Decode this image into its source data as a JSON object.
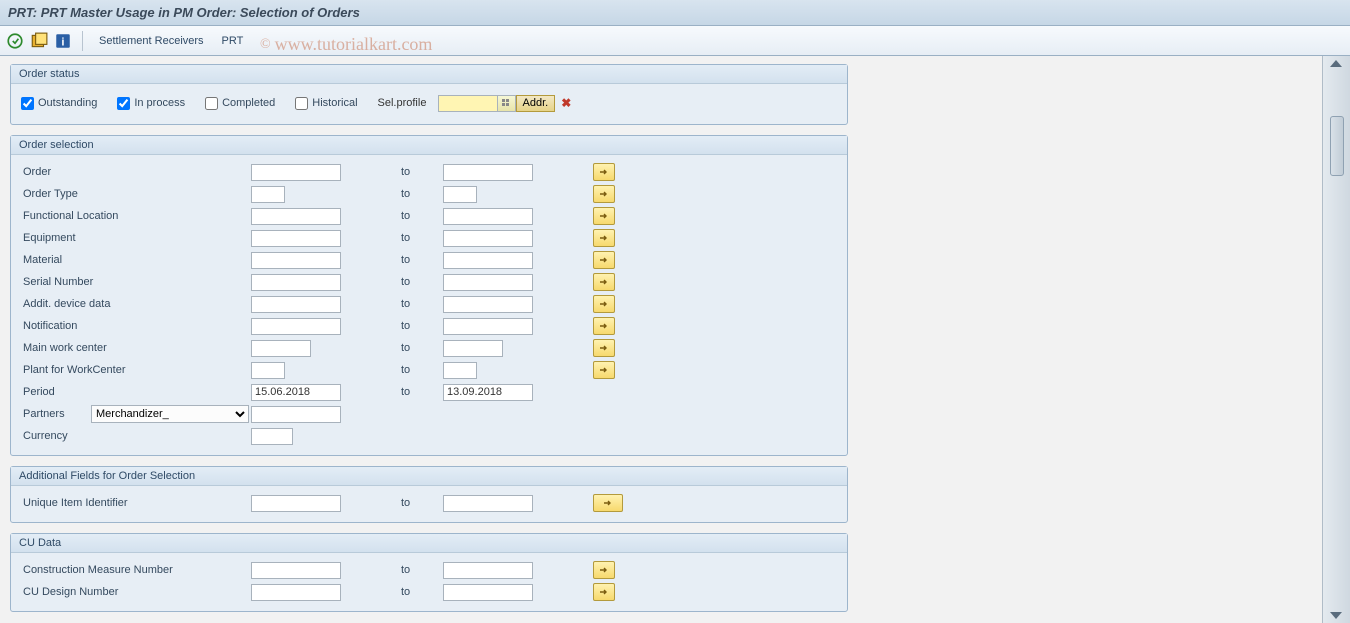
{
  "title": "PRT: PRT Master Usage in PM Order: Selection of Orders",
  "toolbar": {
    "settlement_receivers": "Settlement Receivers",
    "prt": "PRT"
  },
  "watermark": "www.tutorialkart.com",
  "status": {
    "legend": "Order status",
    "outstanding": "Outstanding",
    "in_process": "In process",
    "completed": "Completed",
    "historical": "Historical",
    "sel_profile_label": "Sel.profile",
    "addr_btn": "Addr.",
    "outstanding_checked": true,
    "in_process_checked": true,
    "completed_checked": false,
    "historical_checked": false,
    "sel_profile_value": ""
  },
  "selection": {
    "legend": "Order selection",
    "to_label": "to",
    "rows": {
      "order": {
        "label": "Order",
        "from": "",
        "to": "",
        "from_w": "w90",
        "to_w": "w90",
        "btn": true
      },
      "order_type": {
        "label": "Order Type",
        "from": "",
        "to": "",
        "from_w": "w34",
        "to_w": "w34",
        "btn": true
      },
      "func_loc": {
        "label": "Functional Location",
        "from": "",
        "to": "",
        "from_w": "w90",
        "to_w": "w90",
        "btn": true
      },
      "equipment": {
        "label": "Equipment",
        "from": "",
        "to": "",
        "from_w": "w90",
        "to_w": "w90",
        "btn": true
      },
      "material": {
        "label": "Material",
        "from": "",
        "to": "",
        "from_w": "w90",
        "to_w": "w90",
        "btn": true
      },
      "serial": {
        "label": "Serial Number",
        "from": "",
        "to": "",
        "from_w": "w90",
        "to_w": "w90",
        "btn": true
      },
      "addit_dev": {
        "label": "Addit. device data",
        "from": "",
        "to": "",
        "from_w": "w90",
        "to_w": "w90",
        "btn": true
      },
      "notification": {
        "label": "Notification",
        "from": "",
        "to": "",
        "from_w": "w90",
        "to_w": "w90",
        "btn": true
      },
      "main_wc": {
        "label": "Main work center",
        "from": "",
        "to": "",
        "from_w": "w60",
        "to_w": "w60",
        "btn": true
      },
      "plant_wc": {
        "label": "Plant for WorkCenter",
        "from": "",
        "to": "",
        "from_w": "w34",
        "to_w": "w34",
        "btn": true
      },
      "period": {
        "label": "Period",
        "from": "15.06.2018",
        "to": "13.09.2018",
        "from_w": "w90",
        "to_w": "w90",
        "btn": false
      }
    },
    "partners_label": "Partners",
    "partners_value": "Merchandizer_",
    "partners_input": "",
    "currency_label": "Currency",
    "currency_value": ""
  },
  "additional": {
    "legend": "Additional Fields for Order Selection",
    "to_label": "to",
    "uii": {
      "label": "Unique Item Identifier",
      "from": "",
      "to": ""
    }
  },
  "cu": {
    "legend": "CU Data",
    "to_label": "to",
    "cm_num": {
      "label": "Construction Measure Number",
      "from": "",
      "to": ""
    },
    "cu_design": {
      "label": "CU Design Number",
      "from": "",
      "to": ""
    }
  }
}
